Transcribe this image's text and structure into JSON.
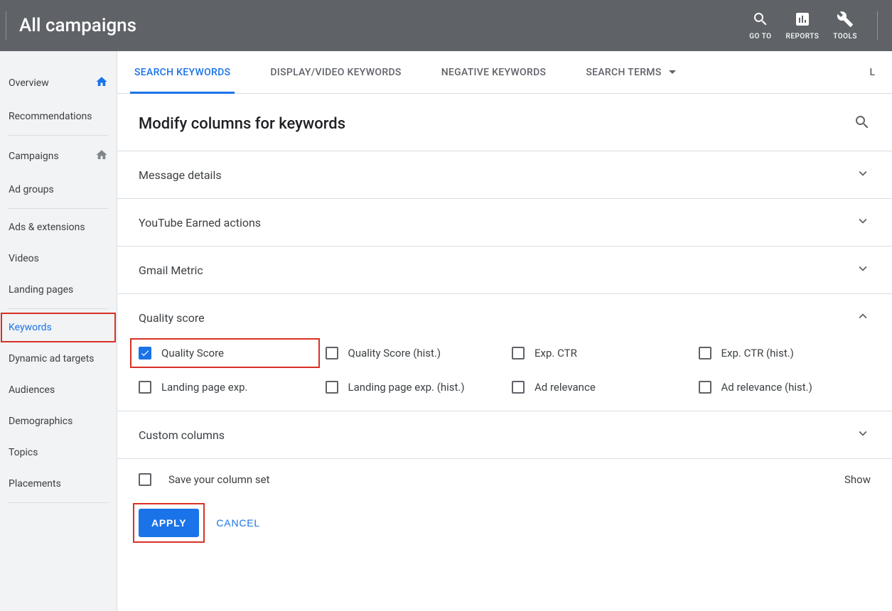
{
  "header": {
    "title": "All campaigns",
    "tools": {
      "goto": "GO TO",
      "reports": "REPORTS",
      "tools": "TOOLS"
    }
  },
  "sidebar": {
    "items": [
      {
        "label": "Overview",
        "icon": "home",
        "active_icon": true
      },
      {
        "label": "Recommendations"
      },
      {
        "divider": true
      },
      {
        "label": "Campaigns",
        "icon": "home-grey"
      },
      {
        "label": "Ad groups"
      },
      {
        "divider": true
      },
      {
        "label": "Ads & extensions"
      },
      {
        "label": "Videos"
      },
      {
        "label": "Landing pages"
      },
      {
        "divider": true
      },
      {
        "label": "Keywords",
        "active": true,
        "highlighted": true
      },
      {
        "label": "Dynamic ad targets"
      },
      {
        "label": "Audiences"
      },
      {
        "label": "Demographics"
      },
      {
        "label": "Topics"
      },
      {
        "label": "Placements"
      },
      {
        "divider": true
      }
    ]
  },
  "tabs": {
    "items": [
      {
        "label": "SEARCH KEYWORDS",
        "active": true
      },
      {
        "label": "DISPLAY/VIDEO KEYWORDS"
      },
      {
        "label": "NEGATIVE KEYWORDS"
      },
      {
        "label": "SEARCH TERMS",
        "dropdown": true
      }
    ],
    "trail": "L"
  },
  "page": {
    "title": "Modify columns for keywords"
  },
  "sections": [
    {
      "title": "Message details",
      "expanded": false
    },
    {
      "title": "YouTube Earned actions",
      "expanded": false
    },
    {
      "title": "Gmail Metric",
      "expanded": false
    },
    {
      "title": "Quality score",
      "expanded": true,
      "checks": [
        {
          "label": "Quality Score",
          "checked": true,
          "highlighted": true
        },
        {
          "label": "Quality Score (hist.)"
        },
        {
          "label": "Exp. CTR"
        },
        {
          "label": "Exp. CTR (hist.)"
        },
        {
          "label": "Landing page exp."
        },
        {
          "label": "Landing page exp. (hist.)"
        },
        {
          "label": "Ad relevance"
        },
        {
          "label": "Ad relevance (hist.)"
        }
      ]
    },
    {
      "title": "Custom columns",
      "expanded": false
    }
  ],
  "save": {
    "label": "Save your column set",
    "show": "Show"
  },
  "actions": {
    "apply": "APPLY",
    "cancel": "CANCEL"
  }
}
